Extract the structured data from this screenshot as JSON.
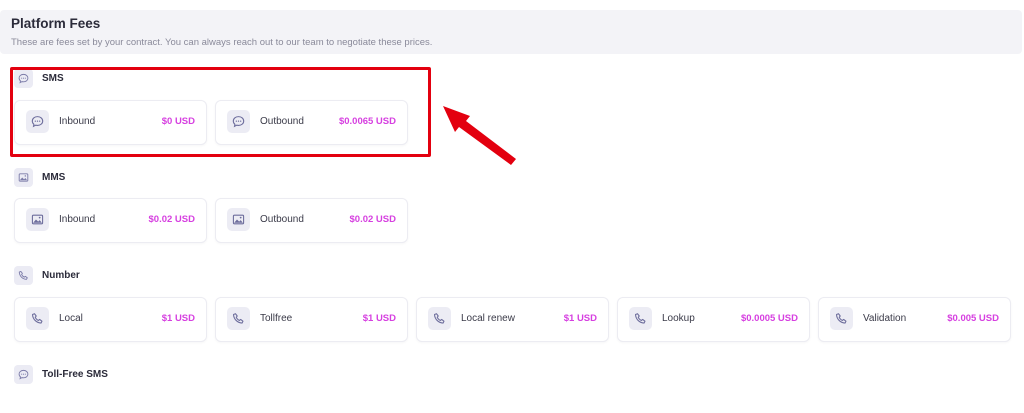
{
  "header": {
    "title": "Platform Fees",
    "subtitle": "These are fees set by your contract. You can always reach out to our team to negotiate these prices."
  },
  "sections": {
    "sms": {
      "label": "SMS",
      "icon": "chat-bubble-icon",
      "items": [
        {
          "label": "Inbound",
          "price": "$0 USD"
        },
        {
          "label": "Outbound",
          "price": "$0.0065 USD"
        }
      ]
    },
    "mms": {
      "label": "MMS",
      "icon": "image-icon",
      "items": [
        {
          "label": "Inbound",
          "price": "$0.02 USD"
        },
        {
          "label": "Outbound",
          "price": "$0.02 USD"
        }
      ]
    },
    "number": {
      "label": "Number",
      "icon": "phone-icon",
      "items": [
        {
          "label": "Local",
          "price": "$1 USD"
        },
        {
          "label": "Tollfree",
          "price": "$1 USD"
        },
        {
          "label": "Local renew",
          "price": "$1 USD"
        },
        {
          "label": "Lookup",
          "price": "$0.0005 USD"
        },
        {
          "label": "Validation",
          "price": "$0.005 USD"
        }
      ]
    },
    "tollfree_sms": {
      "label": "Toll-Free SMS",
      "icon": "chat-bubble-icon"
    }
  },
  "annotation": {
    "highlight_color": "#e3000f",
    "arrow_color": "#e3000f"
  },
  "colors": {
    "price_accent": "#d63fe0",
    "icon_bg": "#ececf4",
    "header_bg": "#f3f3f7"
  }
}
